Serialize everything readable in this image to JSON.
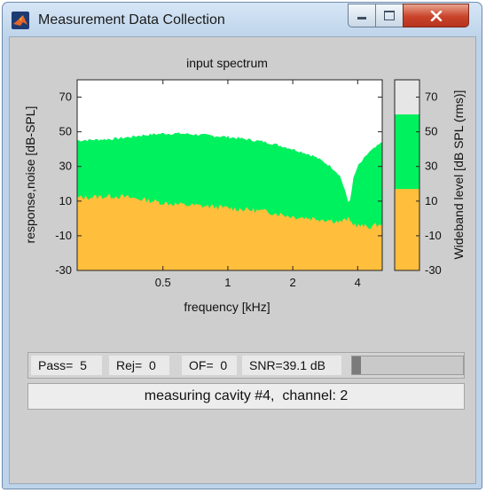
{
  "window": {
    "title": "Measurement Data Collection"
  },
  "window_controls": {
    "minimize": "minimize",
    "maximize": "maximize",
    "close": "close"
  },
  "colors": {
    "response": "#ffbe3c",
    "noise": "#00f15e",
    "plot_bg": "#ffffff"
  },
  "spectrum": {
    "title": "input spectrum",
    "xlabel": "frequency [kHz]",
    "ylabel": "response,noise [dB-SPL]",
    "xticks": [
      "0.5",
      "1",
      "2",
      "4"
    ],
    "yticks": [
      "70",
      "50",
      "30",
      "10",
      "-10",
      "-30"
    ]
  },
  "wideband": {
    "ylabel": "Wideband level [dB SPL (rms)]",
    "yticks": [
      "70",
      "50",
      "30",
      "10",
      "-10",
      "-30"
    ]
  },
  "status": {
    "pass": "Pass=  5",
    "rej": "Rej=  0",
    "of": "OF=  0",
    "snr": "SNR=39.1 dB",
    "progress": 0.08
  },
  "message": "measuring cavity #4,  channel: 2",
  "chart_data": [
    {
      "type": "area",
      "title": "input spectrum",
      "xlabel": "frequency [kHz]",
      "ylabel": "response,noise [dB-SPL]",
      "x_scale": "log",
      "xlim": [
        0.2,
        5.2
      ],
      "ylim": [
        -30,
        80
      ],
      "xticks": [
        0.5,
        1,
        2,
        4
      ],
      "yticks": [
        -30,
        -10,
        10,
        30,
        50,
        70
      ],
      "x": [
        0.2,
        0.3,
        0.4,
        0.5,
        0.6,
        0.8,
        1.0,
        1.5,
        2.0,
        2.5,
        3.0,
        3.3,
        3.5,
        3.6,
        3.7,
        3.8,
        4.0,
        4.5,
        5.2
      ],
      "series": [
        {
          "values": [
            45,
            46,
            48,
            49,
            49,
            48,
            47,
            44,
            40,
            36,
            30,
            25,
            16,
            9,
            11,
            22,
            30,
            38,
            44
          ]
        },
        {
          "values": [
            12,
            13,
            11,
            9,
            8,
            7,
            6,
            4,
            1,
            0,
            -1,
            -2,
            -1,
            0,
            -2,
            -3,
            -4,
            -5,
            -3
          ]
        }
      ]
    },
    {
      "type": "bar",
      "ylabel": "Wideband level [dB SPL (rms)]",
      "ylim": [
        -30,
        80
      ],
      "yticks": [
        -30,
        -10,
        10,
        30,
        50,
        70
      ],
      "series": [
        {
          "values": [
            60
          ]
        },
        {
          "values": [
            17
          ]
        }
      ]
    }
  ]
}
